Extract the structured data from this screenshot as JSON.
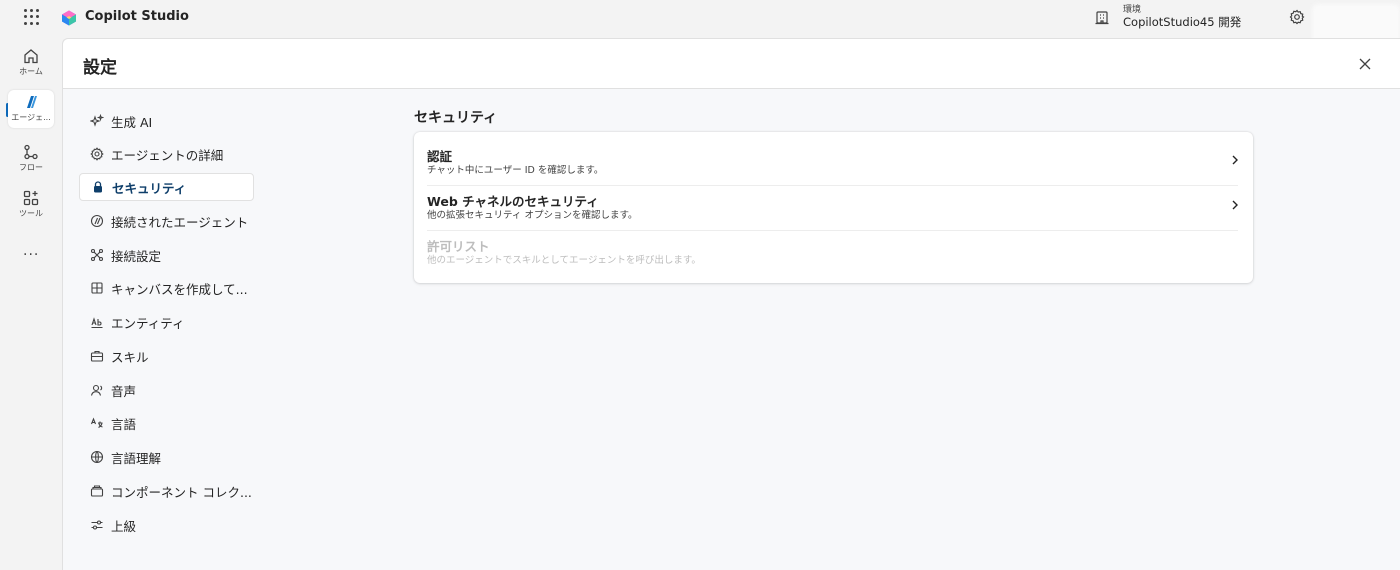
{
  "app": {
    "title": "Copilot Studio"
  },
  "environment": {
    "caption": "環境",
    "name": "CopilotStudio45 開発"
  },
  "rail": {
    "items": [
      {
        "label": "ホーム",
        "icon": "home-icon"
      },
      {
        "label": "エージェ...",
        "icon": "agents-icon"
      },
      {
        "label": "フロー",
        "icon": "flow-icon"
      },
      {
        "label": "ツール",
        "icon": "tools-icon"
      }
    ],
    "more": "..."
  },
  "panel": {
    "title": "設定"
  },
  "nav": {
    "items": [
      {
        "label": "生成 AI",
        "icon": "sparkle-icon"
      },
      {
        "label": "エージェントの詳細",
        "icon": "gear-icon"
      },
      {
        "label": "セキュリティ",
        "icon": "lock-icon",
        "selected": true
      },
      {
        "label": "接続されたエージェント",
        "icon": "connected-agent-icon"
      },
      {
        "label": "接続設定",
        "icon": "connection-icon"
      },
      {
        "label": "キャンバスを作成して...",
        "icon": "canvas-icon"
      },
      {
        "label": "エンティティ",
        "icon": "entity-icon"
      },
      {
        "label": "スキル",
        "icon": "briefcase-icon"
      },
      {
        "label": "音声",
        "icon": "voice-icon"
      },
      {
        "label": "言語",
        "icon": "language-icon"
      },
      {
        "label": "言語理解",
        "icon": "globe-icon"
      },
      {
        "label": "コンポーネント コレク...",
        "icon": "collection-icon"
      },
      {
        "label": "上級",
        "icon": "sliders-icon"
      }
    ]
  },
  "security": {
    "title": "セキュリティ",
    "rows": [
      {
        "title": "認証",
        "subtitle": "チャット中にユーザー ID を確認します。",
        "enabled": true
      },
      {
        "title": "Web チャネルのセキュリティ",
        "subtitle": "他の拡張セキュリティ オプションを確認します。",
        "enabled": true
      },
      {
        "title": "許可リスト",
        "subtitle": "他のエージェントでスキルとしてエージェントを呼び出します。",
        "enabled": false
      }
    ]
  },
  "colors": {
    "accent": "#0f6cbd",
    "selected_text": "#0e3e6a"
  }
}
